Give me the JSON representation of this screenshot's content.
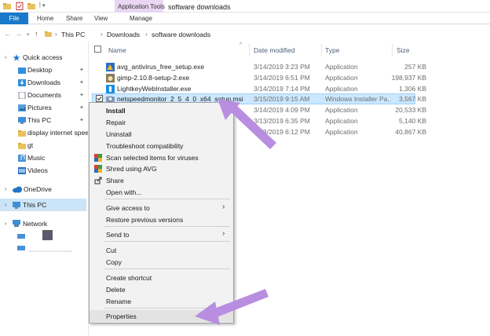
{
  "window": {
    "title": "software downloads",
    "context_tab_group": "Application Tools"
  },
  "ribbon": {
    "tabs": [
      "File",
      "Home",
      "Share",
      "View",
      "Manage"
    ]
  },
  "address": {
    "crumbs": [
      "This PC",
      "Downloads",
      "software downloads"
    ]
  },
  "nav_pane": {
    "quick_access": "Quick access",
    "items": [
      "Desktop",
      "Downloads",
      "Documents",
      "Pictures",
      "This PC",
      "display internet spee",
      "gt",
      "Music",
      "Videos"
    ],
    "onedrive": "OneDrive",
    "this_pc": "This PC",
    "network": "Network"
  },
  "file_list": {
    "columns": [
      "Name",
      "Date modified",
      "Type",
      "Size"
    ],
    "rows": [
      {
        "name": "avg_antivirus_free_setup.exe",
        "date": "3/14/2019 3:23 PM",
        "type": "Application",
        "size": "257 KB"
      },
      {
        "name": "gimp-2.10.8-setup-2.exe",
        "date": "3/14/2019 6:51 PM",
        "type": "Application",
        "size": "198,937 KB"
      },
      {
        "name": "LightkeyWebInstaller.exe",
        "date": "3/14/2019 7:14 PM",
        "type": "Application",
        "size": "1,306 KB"
      },
      {
        "name": "netspeedmonitor_2_5_4_0_x64_setup.msi",
        "date": "3/15/2019 9:15 AM",
        "type": "Windows Installer Pa...",
        "size": "3,567 KB"
      },
      {
        "name": "",
        "date": "3/14/2019 4:09 PM",
        "type": "Application",
        "size": "20,533 KB"
      },
      {
        "name": "",
        "date": "3/13/2019 6:35 PM",
        "type": "Application",
        "size": "5,140 KB"
      },
      {
        "name": "",
        "date": "3/13/2019 6:12 PM",
        "type": "Application",
        "size": "40,867 KB"
      }
    ]
  },
  "context_menu": {
    "install": "Install",
    "repair": "Repair",
    "uninstall": "Uninstall",
    "troubleshoot": "Troubleshoot compatibility",
    "scan": "Scan selected items for viruses",
    "shred": "Shred using AVG",
    "share": "Share",
    "open_with": "Open with...",
    "give_access": "Give access to",
    "restore": "Restore previous versions",
    "send_to": "Send to",
    "cut": "Cut",
    "copy": "Copy",
    "create_shortcut": "Create shortcut",
    "delete": "Delete",
    "rename": "Rename",
    "properties": "Properties"
  },
  "colors": {
    "accent": "#1979ca",
    "selection": "#cce8ff",
    "context_tab": "#e8d6f2",
    "arrow": "#b98ee0"
  }
}
